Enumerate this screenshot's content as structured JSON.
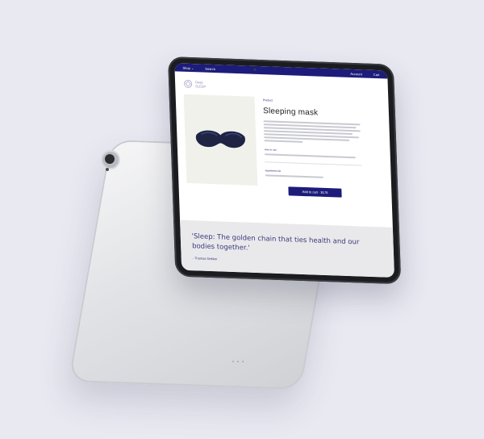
{
  "nav": {
    "shop": "Shop ⌄",
    "search": "Search",
    "account": "Account",
    "cart": "Cart"
  },
  "brand": {
    "line1": "Deep",
    "line2": "SLEEP"
  },
  "product": {
    "breadcrumb": "Product",
    "title": "Sleeping mask",
    "how_to_use_label": "How to use",
    "ingredients_label": "Ingredients list",
    "cta_label": "Add to cart · $178"
  },
  "quote": {
    "text": "'Sleep: The golden chain that ties health and our bodies together.'",
    "author": "- Thomas Dekker"
  },
  "colors": {
    "brand_navy": "#1d1c7a",
    "background": "#e9e9f2"
  }
}
